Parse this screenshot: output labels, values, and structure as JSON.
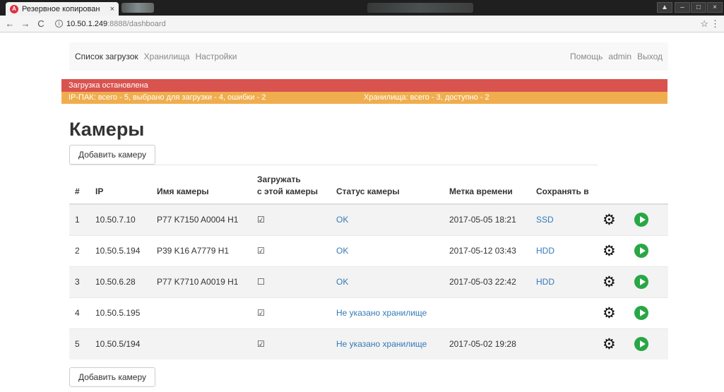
{
  "browser": {
    "tab_title": "Резервное копирован",
    "tab_close": "×",
    "favicon": "A",
    "back": "←",
    "forward": "→",
    "reload": "C",
    "info": "i",
    "url_host": "10.50.1.249",
    "url_path": ":8888/dashboard",
    "star": "☆",
    "menu": "⋮",
    "win_restore": "▲",
    "win_min": "–",
    "win_max": "□",
    "win_close": "×"
  },
  "nav": {
    "items": [
      {
        "label": "Список загрузок",
        "active": true
      },
      {
        "label": "Хранилища",
        "active": false
      },
      {
        "label": "Настройки",
        "active": false
      }
    ],
    "right": [
      {
        "label": "Помощь"
      },
      {
        "label": "admin"
      },
      {
        "label": "Выход"
      }
    ]
  },
  "alerts": {
    "stopped": "Загрузка остановлена",
    "ippak": "IP-ПАК: всего - 5, выбрано для загрузки - 4, ошибки - 2",
    "storages": "Хранилища: всего - 3, доступно - 2",
    "colors": {
      "danger": "#d9534f",
      "warning": "#f0ad4e"
    }
  },
  "page": {
    "title": "Камеры",
    "add_camera": "Добавить камеру"
  },
  "table": {
    "headers": {
      "num": "#",
      "ip": "IP",
      "name": "Имя камеры",
      "upload_1": "Загружать",
      "upload_2": "с этой камеры",
      "status": "Статус камеры",
      "timestamp": "Метка времени",
      "save_to": "Сохранять в"
    },
    "rows": [
      {
        "num": "1",
        "ip": "10.50.7.10",
        "name": "P77 K7150 A0004 H1",
        "upload": "☑",
        "status": "OK",
        "timestamp": "2017-05-05 18:21",
        "save_to": "SSD"
      },
      {
        "num": "2",
        "ip": "10.50.5.194",
        "name": "P39 K16 A7779 H1",
        "upload": "☑",
        "status": "OK",
        "timestamp": "2017-05-12 03:43",
        "save_to": "HDD"
      },
      {
        "num": "3",
        "ip": "10.50.6.28",
        "name": "P77 K7710 A0019 H1",
        "upload": "☐",
        "status": "OK",
        "timestamp": "2017-05-03 22:42",
        "save_to": "HDD"
      },
      {
        "num": "4",
        "ip": "10.50.5.195",
        "name": "",
        "upload": "☑",
        "status": "Не указано хранилище",
        "timestamp": "",
        "save_to": ""
      },
      {
        "num": "5",
        "ip": "10.50.5/194",
        "name": "",
        "upload": "☑",
        "status": "Не указано хранилище",
        "timestamp": "2017-05-02 19:28",
        "save_to": ""
      }
    ],
    "icons": {
      "settings": "gear-icon",
      "start": "play-icon",
      "gear_glyph": "⚙"
    }
  }
}
